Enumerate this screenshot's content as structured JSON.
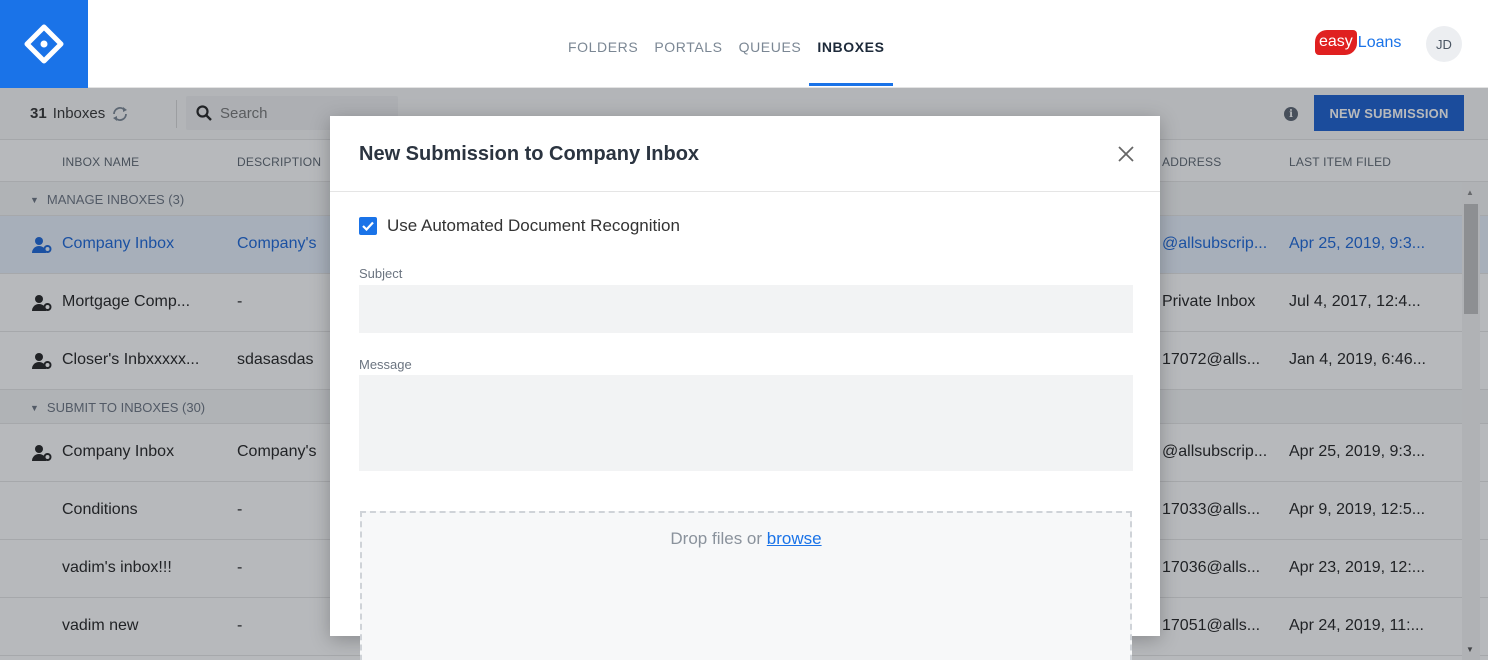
{
  "nav": {
    "items": [
      {
        "label": "FOLDERS",
        "active": false
      },
      {
        "label": "PORTALS",
        "active": false
      },
      {
        "label": "QUEUES",
        "active": false
      },
      {
        "label": "INBOXES",
        "active": true
      }
    ]
  },
  "brand": {
    "easy": "easy",
    "loans": "Loans"
  },
  "user": {
    "initials": "JD"
  },
  "toolbar": {
    "count": "31",
    "count_label": "Inboxes",
    "search_placeholder": "Search",
    "new_submission_label": "NEW SUBMISSION"
  },
  "table": {
    "headers": {
      "name": "INBOX NAME",
      "description": "DESCRIPTION",
      "address": "ADDRESS",
      "last": "LAST ITEM FILED"
    },
    "groups": [
      {
        "label": "MANAGE INBOXES (3)",
        "rows": [
          {
            "name": "Company Inbox",
            "description": "Company's",
            "address": "@allsubscrip...",
            "last": "Apr 25, 2019, 9:3...",
            "icon": "user-group-icon",
            "selected": true
          },
          {
            "name": "Mortgage Comp...",
            "description": "-",
            "address": "Private Inbox",
            "last": "Jul 4, 2017, 12:4...",
            "icon": "user-group-icon",
            "selected": false
          },
          {
            "name": "Closer's Inbxxxxx...",
            "description": "sdasasdas",
            "address": "17072@alls...",
            "last": "Jan 4, 2019, 6:46...",
            "icon": "user-group-icon",
            "selected": false
          }
        ]
      },
      {
        "label": "SUBMIT TO INBOXES (30)",
        "rows": [
          {
            "name": "Company Inbox",
            "description": "Company's",
            "address": "@allsubscrip...",
            "last": "Apr 25, 2019, 9:3...",
            "icon": "user-group-icon",
            "selected": false
          },
          {
            "name": "Conditions",
            "description": "-",
            "address": "17033@alls...",
            "last": "Apr 9, 2019, 12:5...",
            "icon": "",
            "selected": false
          },
          {
            "name": "vadim's inbox!!!",
            "description": "-",
            "address": "17036@alls...",
            "last": "Apr 23, 2019, 12:...",
            "icon": "",
            "selected": false
          },
          {
            "name": "vadim new",
            "description": "-",
            "address": "17051@alls...",
            "last": "Apr 24, 2019, 11:...",
            "icon": "",
            "selected": false
          }
        ]
      }
    ]
  },
  "modal": {
    "title": "New Submission to Company Inbox",
    "auto_recognition_label": "Use Automated Document Recognition",
    "auto_recognition_checked": true,
    "subject_label": "Subject",
    "subject_value": "",
    "message_label": "Message",
    "message_value": "",
    "drop_text": "Drop files or",
    "browse_label": "browse"
  },
  "colors": {
    "accent": "#1a73e8",
    "primary_button": "#1a5fd0",
    "brand_red": "#e02020",
    "selected_row": "#e8f0fc"
  }
}
